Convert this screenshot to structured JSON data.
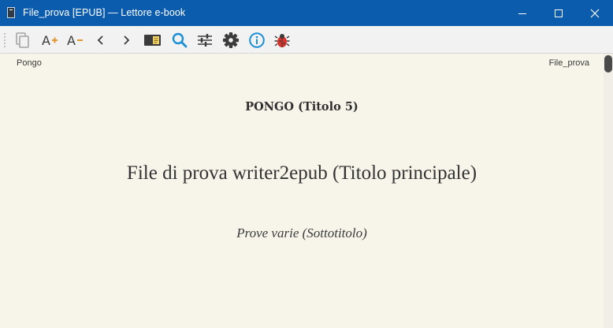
{
  "window": {
    "title": "File_prova [EPUB] — Lettore e-book",
    "accent": "#0b5cad"
  },
  "toolbar": {
    "icons": [
      "copy-icon",
      "font-increase-icon",
      "font-decrease-icon",
      "back-icon",
      "forward-icon",
      "toc-icon",
      "search-icon",
      "preferences-icon",
      "settings-icon",
      "info-icon",
      "debug-icon"
    ],
    "font_increase_glyph": "A",
    "font_decrease_glyph": "A"
  },
  "reader": {
    "header_left": "Pongo",
    "header_right": "File_prova",
    "heading5": "PONGO (Titolo 5)",
    "main_title": "File di prova writer2epub (Titolo principale)",
    "subtitle": "Prove varie (Sottotitolo)",
    "background": "#f7f4ea"
  }
}
